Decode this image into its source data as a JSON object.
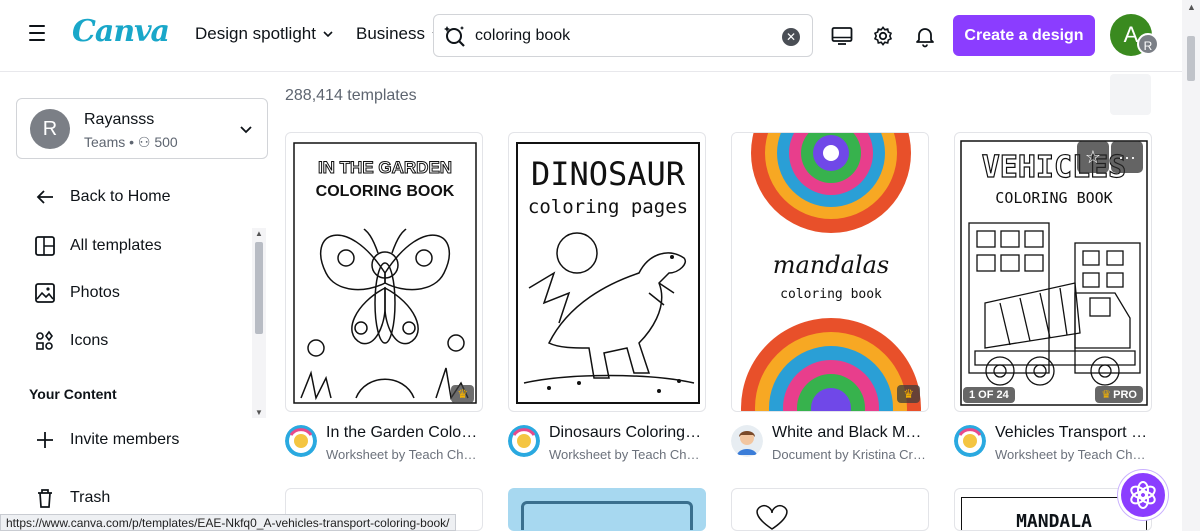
{
  "header": {
    "logo": "Canva",
    "nav": [
      {
        "label": "Design spotlight"
      },
      {
        "label": "Business"
      }
    ],
    "search": {
      "value": "coloring book",
      "placeholder": "Search"
    },
    "create_button": "Create a design",
    "avatar_initial": "A",
    "avatar_sub_initial": "R"
  },
  "sidebar": {
    "team": {
      "initial": "R",
      "name": "Rayansss",
      "sub": "Teams • ⚇ 500"
    },
    "items": [
      {
        "label": "Back to Home",
        "icon": "arrow-left-icon"
      },
      {
        "label": "All templates",
        "icon": "templates-icon"
      },
      {
        "label": "Photos",
        "icon": "photo-icon"
      },
      {
        "label": "Icons",
        "icon": "shapes-icon"
      }
    ],
    "section_title": "Your Content",
    "bottom_items": [
      {
        "label": "Invite members",
        "icon": "plus-icon"
      },
      {
        "label": "Trash",
        "icon": "trash-icon"
      }
    ]
  },
  "main": {
    "count": "288,414 templates",
    "cards": [
      {
        "title": "In the Garden Coloring Book",
        "sub": "Worksheet by Teach Cheer",
        "art_line1": "IN THE GARDEN",
        "art_line2": "COLORING BOOK",
        "badge": "♛"
      },
      {
        "title": "Dinosaurs Coloring Pages",
        "sub": "Worksheet by Teach Cheer",
        "art_line1": "DINOSAUR",
        "art_line2": "coloring pages"
      },
      {
        "title": "White and Black Mandalas",
        "sub": "Document by Kristina Creative",
        "art_line1": "mandalas",
        "art_line2": "coloring book",
        "badge": "♛"
      },
      {
        "title": "Vehicles Transport Coloring Book",
        "sub": "Worksheet by Teach Cheer",
        "art_line1": "VEHICLES",
        "art_line2": "COLORING BOOK",
        "page_badge": "1 OF 24",
        "pro_badge": "PRO"
      }
    ],
    "row2_label": "MANDALA"
  },
  "status_url": "https://www.canva.com/p/templates/EAE-Nkfq0_A-vehicles-transport-coloring-book/",
  "colors": {
    "brand": "#8b3dff",
    "logo": "#19a7c9"
  }
}
